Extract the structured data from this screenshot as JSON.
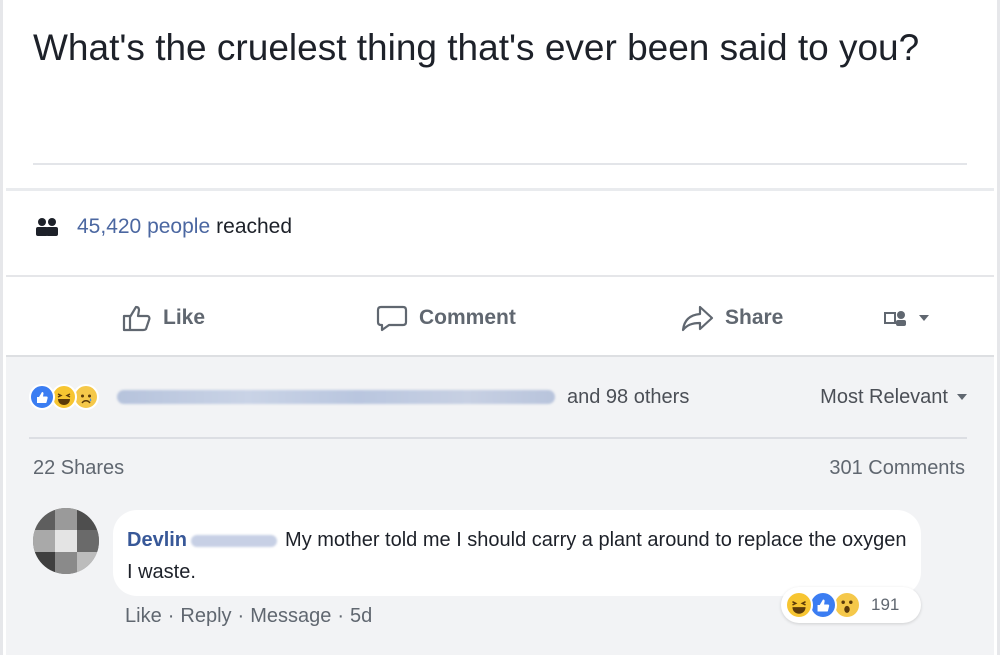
{
  "post": {
    "text": "What's the cruelest thing that's ever been said to you?",
    "reach_count": "45,420 people",
    "reach_suffix": "reached"
  },
  "actions": {
    "like": "Like",
    "comment": "Comment",
    "share": "Share"
  },
  "reactions_summary": {
    "others": "and 98 others",
    "sort": "Most Relevant",
    "shares": "22 Shares",
    "comments": "301 Comments",
    "icons": [
      "like-icon",
      "haha-icon",
      "sad-icon"
    ]
  },
  "comment": {
    "author": "Devlin",
    "text": "My mother told me I should carry a plant around to replace the oxygen I waste.",
    "reaction_count": "191",
    "reaction_icons": [
      "haha-icon",
      "like-icon",
      "wow-icon"
    ],
    "like": "Like",
    "reply": "Reply",
    "message": "Message",
    "time": "5d"
  },
  "colors": {
    "link_blue": "#385898",
    "reach_blue": "#4b67a1",
    "muted": "#606770",
    "background_grey": "#f2f3f5"
  }
}
